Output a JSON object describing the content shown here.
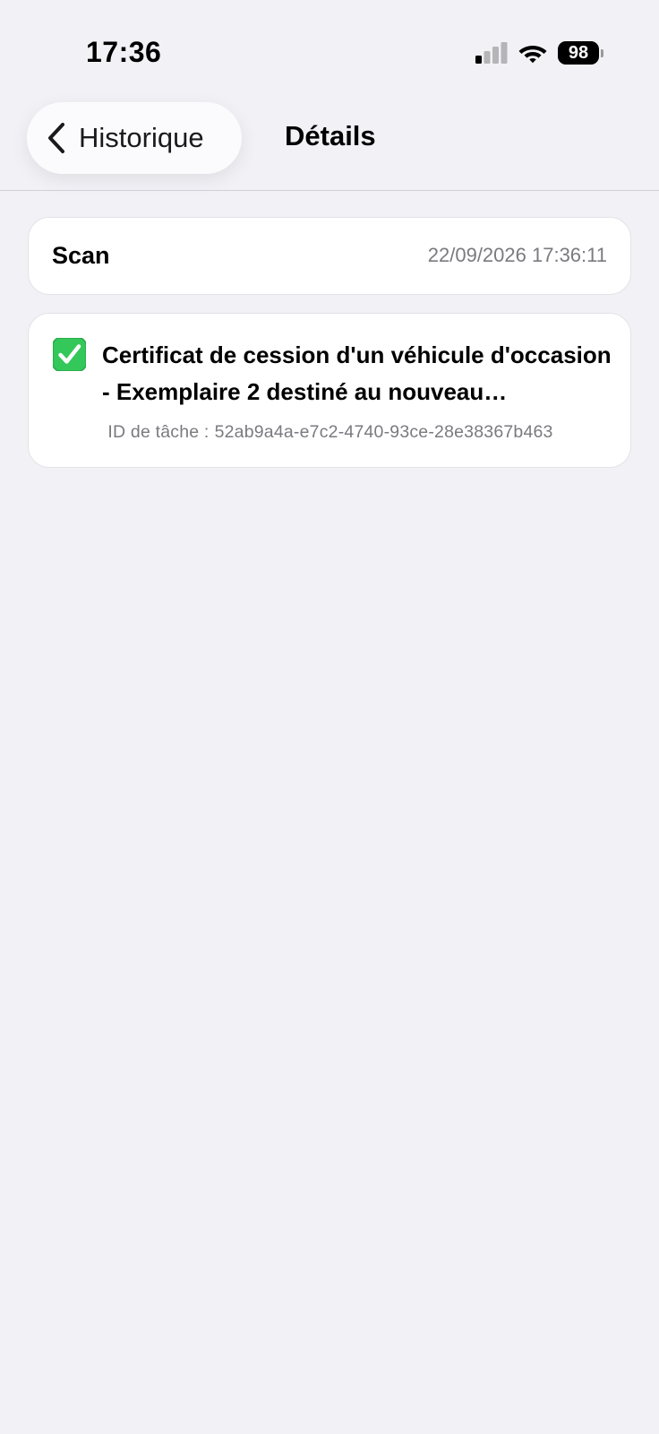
{
  "status_bar": {
    "time": "17:36",
    "battery": "98",
    "icons": [
      "cellular-signal-icon",
      "wifi-icon",
      "battery-icon"
    ]
  },
  "nav": {
    "back_label": "Historique",
    "title": "Détails"
  },
  "scan": {
    "label": "Scan",
    "datetime": "22/09/2026 17:36:11"
  },
  "task": {
    "status_icon": "check-mark-icon",
    "title": "Certificat de cession d'un véhicule d'occasion - Exemplaire 2 destiné au nouveau propriétaire",
    "id_label": "ID de tâche :",
    "id_value": "52ab9a4a-e7c2-4740-93ce-28e38367b463"
  },
  "colors": {
    "background": "#f1f1f6",
    "card": "#ffffff",
    "secondary_text": "#7a7a7f",
    "check_green": "#34c759"
  }
}
